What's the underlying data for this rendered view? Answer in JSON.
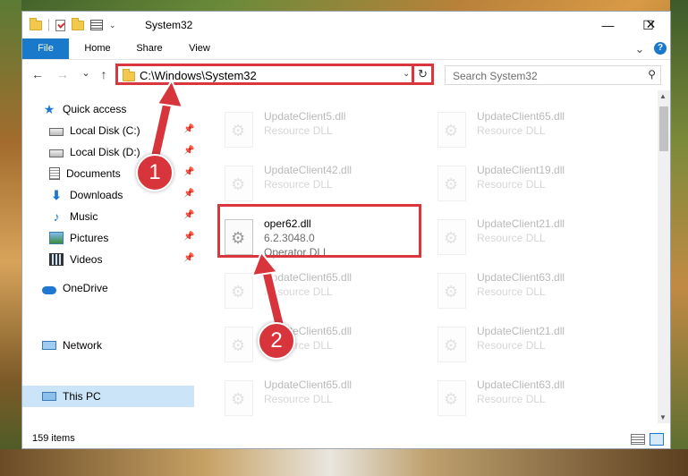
{
  "window": {
    "title": "System32",
    "minimize_glyph": "—",
    "maximize_glyph": "☐",
    "close_glyph": "✕"
  },
  "ribbon": {
    "tabs": [
      "File",
      "Home",
      "Share",
      "View"
    ],
    "collapse_glyph": "⌄",
    "help_glyph": "?"
  },
  "navigation": {
    "back_glyph": "←",
    "forward_glyph": "→",
    "recent_glyph": "⌄",
    "up_glyph": "↑",
    "address_path": "C:\\Windows\\System32",
    "address_dropdown_glyph": "⌄",
    "refresh_glyph": "↻",
    "search_placeholder": "Search System32",
    "search_glyph": "⚲"
  },
  "sidebar": {
    "items": [
      {
        "label": "Quick access",
        "icon": "star-icon",
        "pinned": false
      },
      {
        "label": "Local Disk (C:)",
        "icon": "drive-icon",
        "pinned": true
      },
      {
        "label": "Local Disk (D:)",
        "icon": "drive-icon",
        "pinned": true
      },
      {
        "label": "Documents",
        "icon": "documents-icon",
        "pinned": true
      },
      {
        "label": "Downloads",
        "icon": "download-icon",
        "pinned": true
      },
      {
        "label": "Music",
        "icon": "music-icon",
        "pinned": true
      },
      {
        "label": "Pictures",
        "icon": "pictures-icon",
        "pinned": true
      },
      {
        "label": "Videos",
        "icon": "videos-icon",
        "pinned": true
      },
      {
        "label": "OneDrive",
        "icon": "onedrive-icon",
        "pinned": false
      },
      {
        "label": "This PC",
        "icon": "this-pc-icon",
        "pinned": false,
        "selected": true
      },
      {
        "label": "Network",
        "icon": "network-icon",
        "pinned": false
      }
    ],
    "star_glyph": "★",
    "download_glyph": "⬇",
    "music_glyph": "♪",
    "pin_glyph": "📌"
  },
  "files": [
    {
      "name": "UpdateClient5.dll",
      "type": "Resource DLL",
      "faded": true
    },
    {
      "name": "UpdateClient65.dll",
      "type": "Resource DLL",
      "faded": true
    },
    {
      "name": "UpdateClient42.dll",
      "type": "Resource DLL",
      "faded": true
    },
    {
      "name": "UpdateClient19.dll",
      "type": "Resource DLL",
      "faded": true
    },
    {
      "name": "oper62.dll",
      "version": "6.2.3048.0",
      "type": "Operator DLL",
      "faded": false
    },
    {
      "name": "UpdateClient21.dll",
      "type": "Resource DLL",
      "faded": true
    },
    {
      "name": "UpdateClient65.dll",
      "type": "Resource DLL",
      "faded": true
    },
    {
      "name": "UpdateClient63.dll",
      "type": "Resource DLL",
      "faded": true
    },
    {
      "name": "UpdateClient65.dll",
      "type": "Resource DLL",
      "faded": true
    },
    {
      "name": "UpdateClient21.dll",
      "type": "Resource DLL",
      "faded": true
    },
    {
      "name": "UpdateClient65.dll",
      "type": "Resource DLL",
      "faded": true
    },
    {
      "name": "UpdateClient63.dll",
      "type": "Resource DLL",
      "faded": true
    }
  ],
  "gear_glyph": "⚙",
  "scroll": {
    "up_glyph": "▲",
    "down_glyph": "▼"
  },
  "status": {
    "item_count": "159 items"
  },
  "callouts": [
    "1",
    "2"
  ],
  "colors": {
    "accent": "#1979ca",
    "highlight": "#d9363e",
    "selection": "#cce4f7"
  }
}
